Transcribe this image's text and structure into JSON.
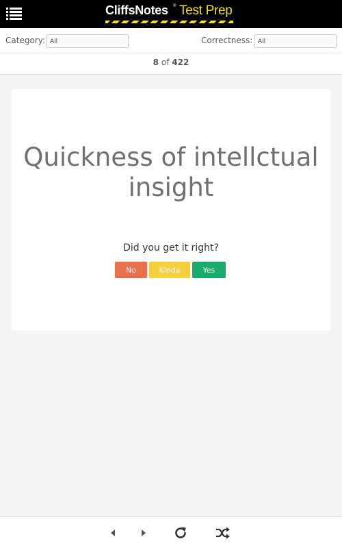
{
  "header": {
    "brand_primary": "CliffsNotes",
    "brand_mark": "®",
    "brand_secondary": "Test Prep",
    "brand_yellow": "#f5e11a",
    "menu_icon": "list-menu-icon"
  },
  "filters": {
    "category_label": "Category:",
    "category_value": "All",
    "correctness_label": "Correctness:",
    "correctness_value": "All"
  },
  "counter": {
    "current": "8",
    "separator": "of",
    "total": "422"
  },
  "card": {
    "term": "Quickness of intellctual insight",
    "question": "Did you get it right?",
    "buttons": {
      "no": {
        "label": "No",
        "color": "#e8704f"
      },
      "kinda": {
        "label": "Kinda",
        "color": "#f6cf3e"
      },
      "yes": {
        "label": "Yes",
        "color": "#1aab6b"
      }
    }
  },
  "toolbar": {
    "icons": [
      "previous-icon",
      "next-icon",
      "refresh-icon",
      "shuffle-icon"
    ]
  }
}
